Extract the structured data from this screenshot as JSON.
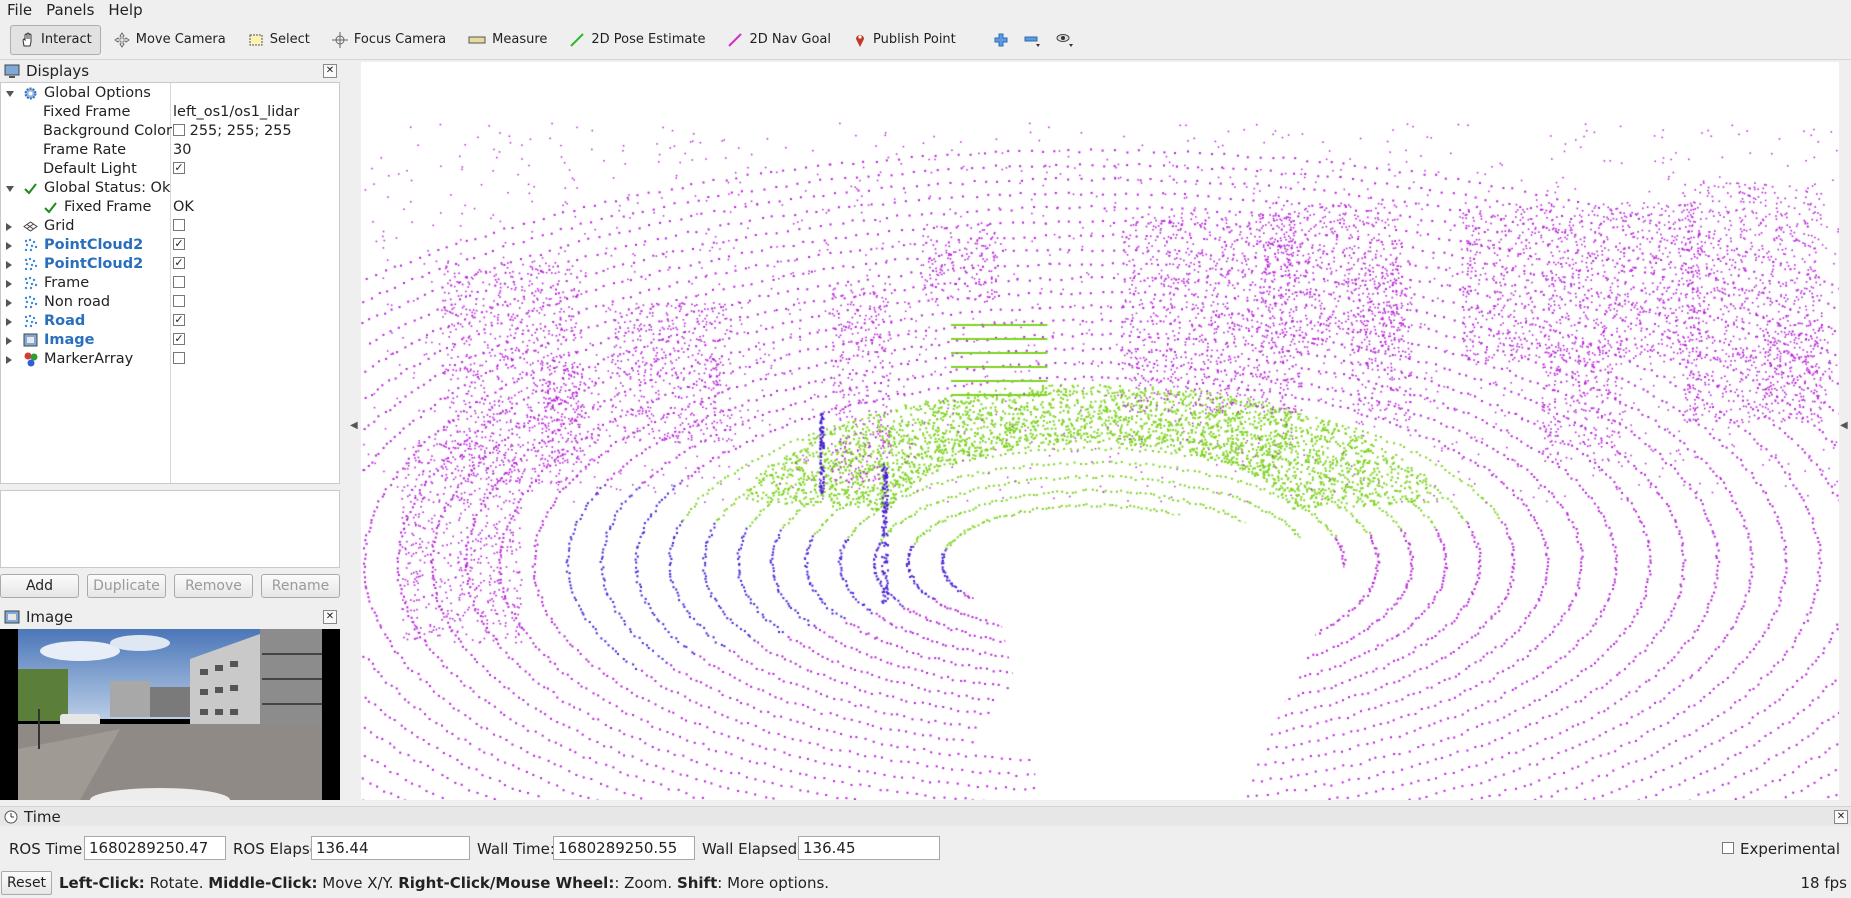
{
  "menu": [
    "File",
    "Panels",
    "Help"
  ],
  "toolbar": {
    "tools": [
      {
        "label": "Interact",
        "icon": "hand-icon",
        "active": true
      },
      {
        "label": "Move Camera",
        "icon": "move-camera-icon",
        "active": false
      },
      {
        "label": "Select",
        "icon": "select-icon",
        "active": false
      },
      {
        "label": "Focus Camera",
        "icon": "focus-camera-icon",
        "active": false
      },
      {
        "label": "Measure",
        "icon": "measure-icon",
        "active": false
      },
      {
        "label": "2D Pose Estimate",
        "icon": "pose-estimate-icon",
        "active": false
      },
      {
        "label": "2D Nav Goal",
        "icon": "nav-goal-icon",
        "active": false
      },
      {
        "label": "Publish Point",
        "icon": "publish-point-icon",
        "active": false
      }
    ]
  },
  "displays_panel": {
    "title": "Displays",
    "rows": [
      {
        "label": "Global Options",
        "value": "",
        "checked": null,
        "indent": 0,
        "expand": "down",
        "style": "normal"
      },
      {
        "label": "Fixed Frame",
        "value": "left_os1/os1_lidar",
        "checked": null,
        "indent": 1,
        "expand": "",
        "style": "normal"
      },
      {
        "label": "Background Color",
        "value": "255; 255; 255",
        "checked": null,
        "indent": 1,
        "expand": "",
        "style": "normal"
      },
      {
        "label": "Frame Rate",
        "value": "30",
        "checked": null,
        "indent": 1,
        "expand": "",
        "style": "normal"
      },
      {
        "label": "Default Light",
        "value": "",
        "checked": true,
        "indent": 1,
        "expand": "",
        "style": "normal"
      },
      {
        "label": "Global Status: Ok",
        "value": "",
        "checked": null,
        "indent": 0,
        "expand": "down",
        "style": "normal"
      },
      {
        "label": "Fixed Frame",
        "value": "OK",
        "checked": null,
        "indent": 1,
        "expand": "",
        "style": "normal"
      },
      {
        "label": "Grid",
        "value": "",
        "checked": false,
        "indent": 0,
        "expand": "right",
        "style": "normal"
      },
      {
        "label": "PointCloud2",
        "value": "",
        "checked": true,
        "indent": 0,
        "expand": "right",
        "style": "blue"
      },
      {
        "label": "PointCloud2",
        "value": "",
        "checked": true,
        "indent": 0,
        "expand": "right",
        "style": "blue"
      },
      {
        "label": "Frame",
        "value": "",
        "checked": false,
        "indent": 0,
        "expand": "right",
        "style": "normal"
      },
      {
        "label": "Non road",
        "value": "",
        "checked": false,
        "indent": 0,
        "expand": "right",
        "style": "normal"
      },
      {
        "label": "Road",
        "value": "",
        "checked": true,
        "indent": 0,
        "expand": "right",
        "style": "blue"
      },
      {
        "label": "Image",
        "value": "",
        "checked": true,
        "indent": 0,
        "expand": "right",
        "style": "blue"
      },
      {
        "label": "MarkerArray",
        "value": "",
        "checked": false,
        "indent": 0,
        "expand": "right",
        "style": "normal"
      }
    ],
    "buttons": {
      "add": "Add",
      "duplicate": "Duplicate",
      "remove": "Remove",
      "rename": "Rename"
    }
  },
  "image_panel": {
    "title": "Image"
  },
  "time_panel": {
    "title": "Time",
    "ros_time_label": "ROS Time:",
    "ros_time": "1680289250.47",
    "ros_elapsed_label": "ROS Elapsed:",
    "ros_elapsed": "136.44",
    "wall_time_label": "Wall Time:",
    "wall_time": "1680289250.55",
    "wall_elapsed_label": "Wall Elapsed:",
    "wall_elapsed": "136.45",
    "experimental_label": "Experimental"
  },
  "status": {
    "reset_label": "Reset",
    "left_click": "Left-Click:",
    "left_click_desc": " Rotate. ",
    "middle_click": "Middle-Click:",
    "middle_click_desc": " Move X/Y. ",
    "right_click": "Right-Click/Mouse Wheel:",
    "right_click_desc": ": Zoom. ",
    "shift": "Shift",
    "shift_desc": ": More options.",
    "fps": "18 fps"
  },
  "colors": {
    "non_road_points": "#b620d6",
    "road_points": "#7ed321",
    "near_points": "#4a20d6",
    "accent_blue": "#2a6fbd"
  }
}
